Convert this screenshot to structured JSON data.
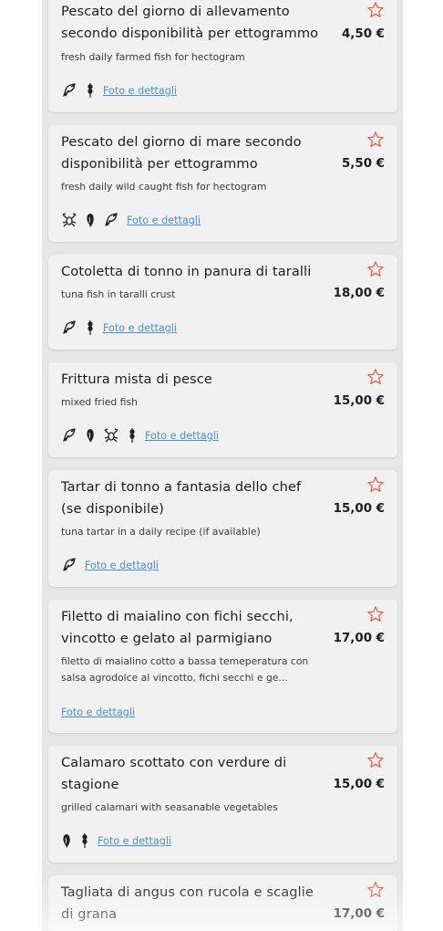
{
  "accent_color": "#e4553d",
  "link_color": "#4a8fc9",
  "items": [
    {
      "title": "Pescato del giorno di allevamento secondo disponibilità per ettogrammo",
      "price": "4,50 €",
      "desc": "fresh daily farmed fish for hectogram",
      "link": "Foto e dettagli",
      "icons": [
        "fish-icon",
        "gluten-icon"
      ]
    },
    {
      "title": "Pescato del giorno di mare secondo disponibilità  per ettogrammo",
      "price": "5,50 €",
      "desc": "fresh daily wild caught fish for hectogram",
      "link": "Foto e dettagli",
      "icons": [
        "crustacean-icon",
        "mollusc-icon",
        "fish-icon"
      ]
    },
    {
      "title": "Cotoletta di tonno in panura di taralli",
      "price": "18,00 €",
      "desc": "tuna fish in taralli crust",
      "link": "Foto e dettagli",
      "icons": [
        "fish-icon",
        "gluten-icon"
      ]
    },
    {
      "title": "Frittura mista di pesce",
      "price": "15,00 €",
      "desc": "mixed fried fish",
      "link": "Foto e dettagli",
      "icons": [
        "fish-icon",
        "mollusc-icon",
        "crustacean-icon",
        "gluten-icon"
      ]
    },
    {
      "title": "Tartar di tonno a fantasia dello chef (se disponibile)",
      "price": "15,00 €",
      "desc": "tuna tartar in a daily recipe (if available)",
      "link": "Foto e dettagli",
      "icons": [
        "fish-icon"
      ]
    },
    {
      "title": "Filetto di maialino con fichi secchi, vincotto e gelato al parmigiano",
      "price": "17,00 €",
      "desc": "filetto di maialino cotto a bassa temeperatura con salsa agrodolce al vincotto, fichi secchi e ge...",
      "link": "Foto e dettagli",
      "icons": []
    },
    {
      "title": "Calamaro scottato con verdure di stagione",
      "price": "15,00 €",
      "desc": "grilled calamari with seasanable vegetables",
      "link": "Foto e dettagli",
      "icons": [
        "mollusc-icon",
        "gluten-icon"
      ]
    },
    {
      "title": "Tagliata di angus con rucola e scaglie di grana",
      "price": "17,00 €"
    }
  ]
}
